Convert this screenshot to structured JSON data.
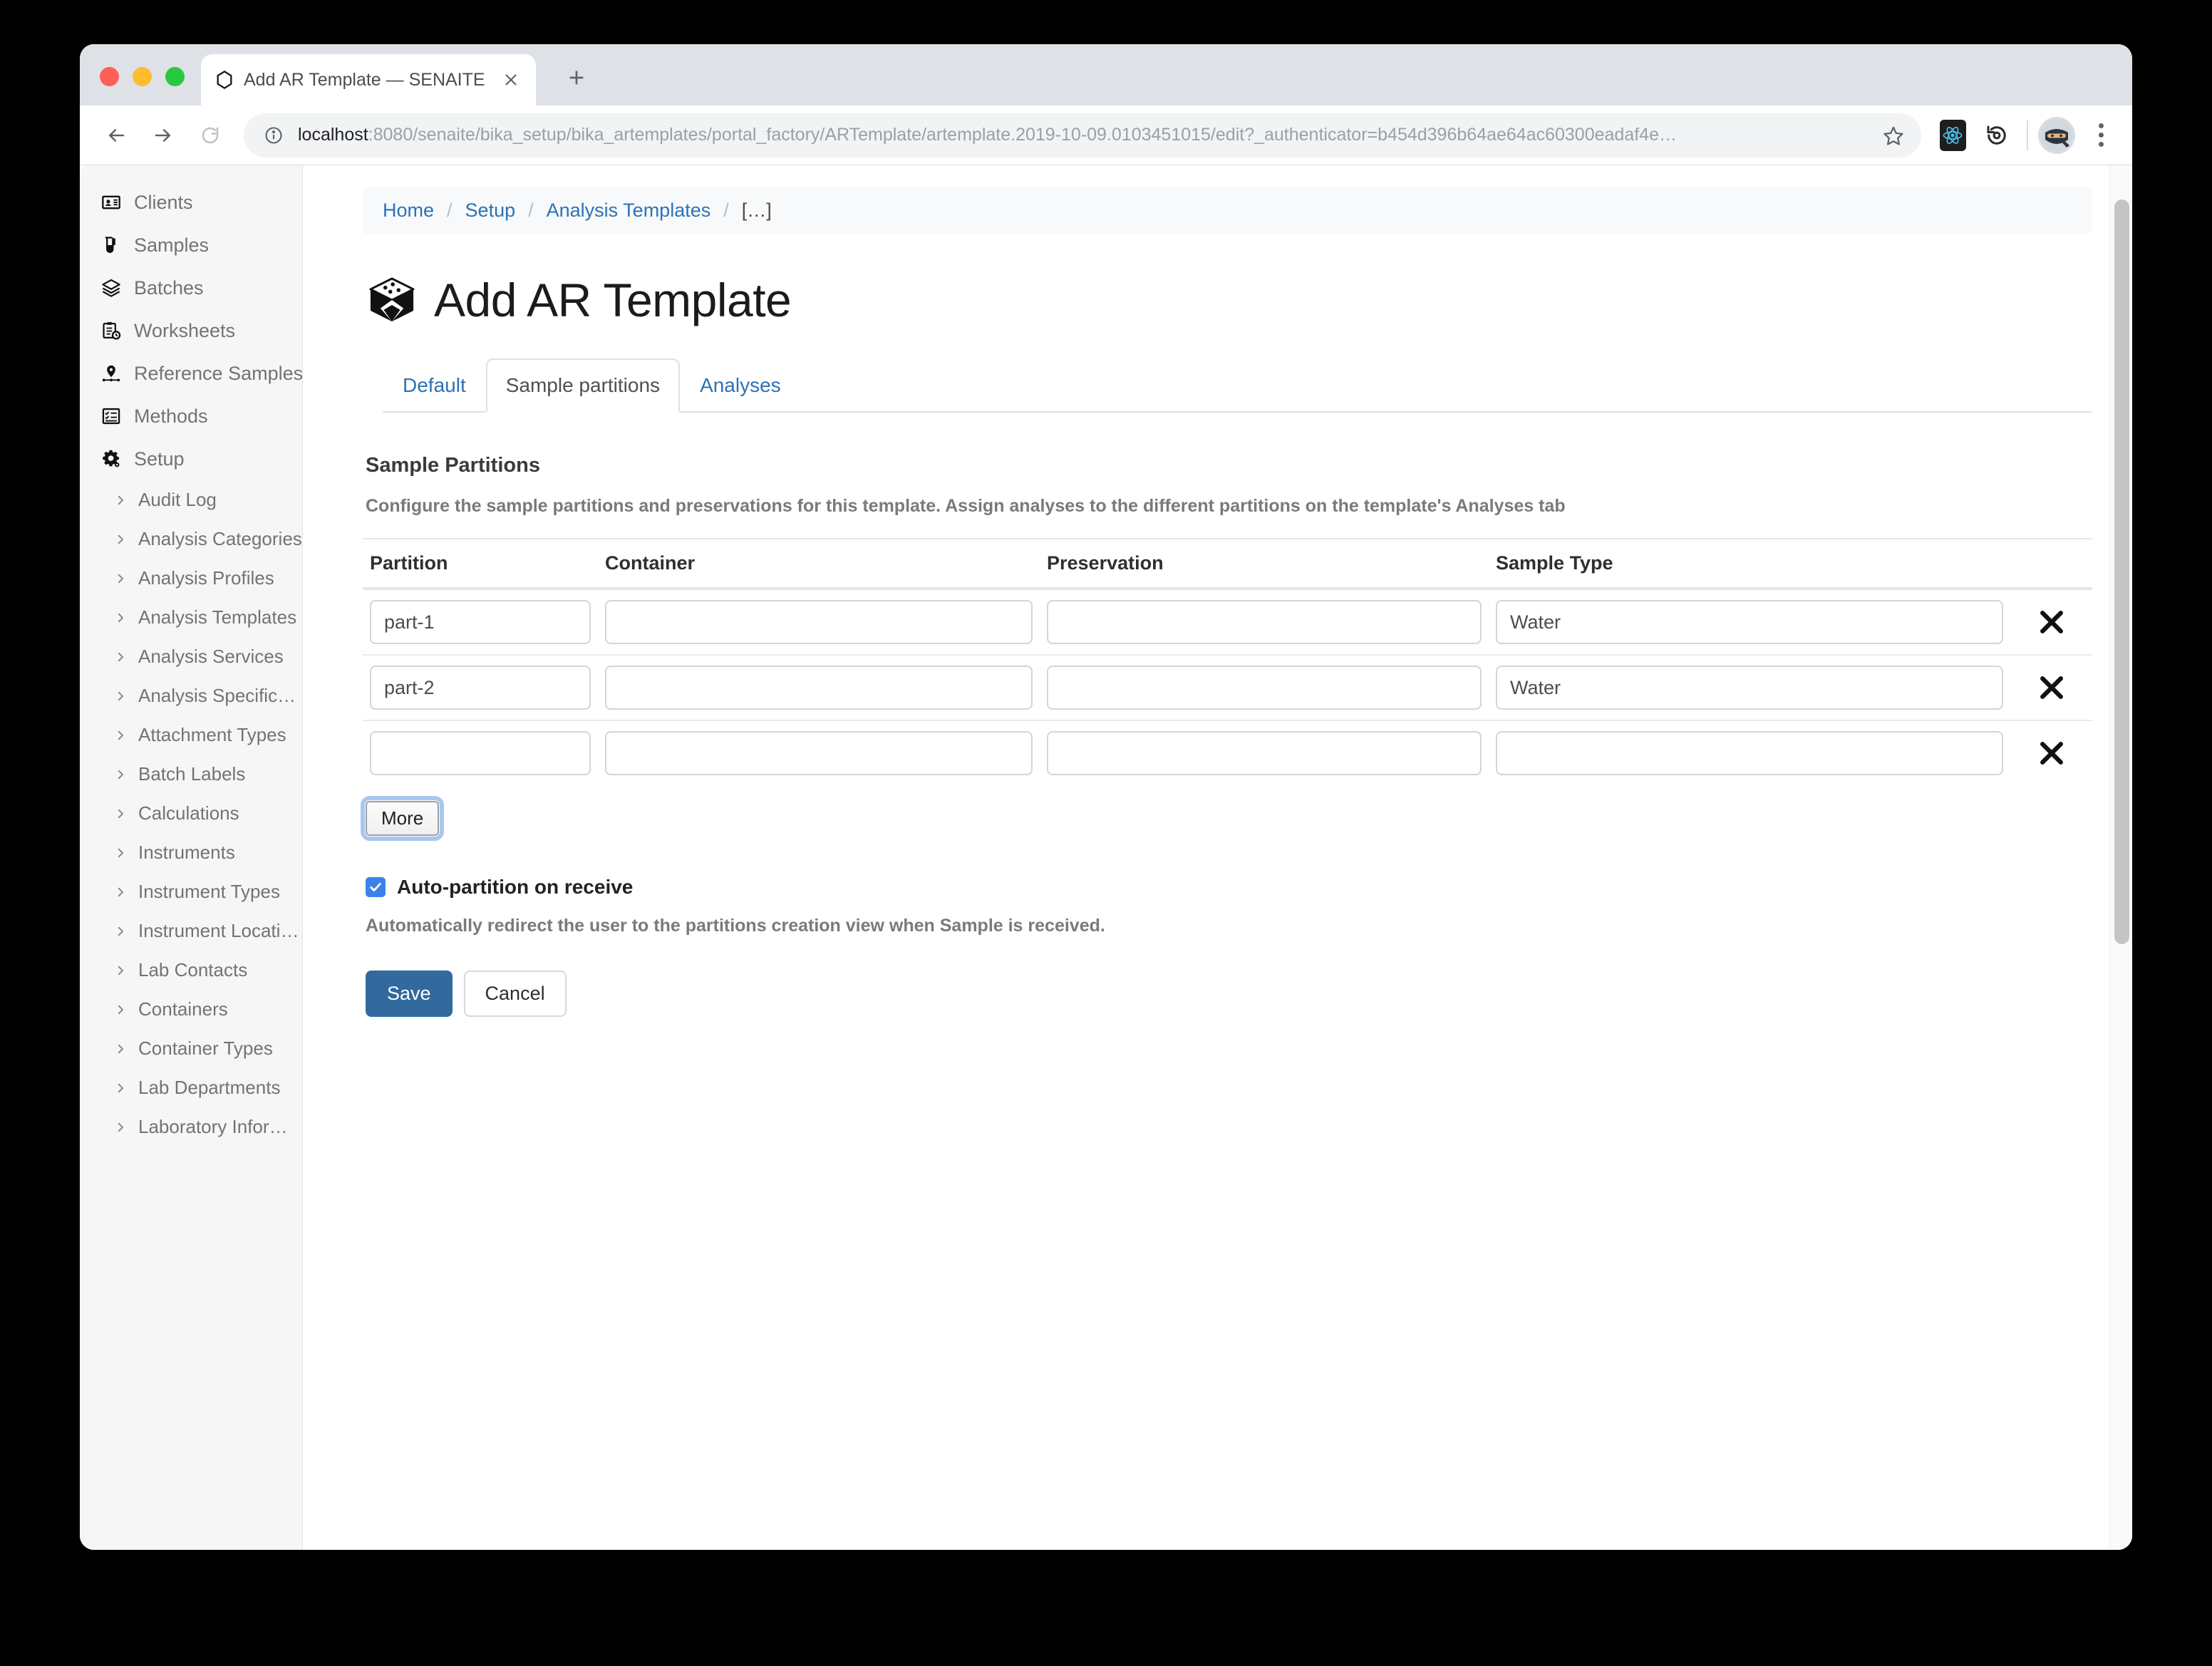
{
  "browser": {
    "tab": {
      "title": "Add AR Template — SENAITE",
      "favicon_icon": "senaite-hexagon-icon",
      "close_icon": "close-icon"
    },
    "new_tab_icon": "plus-icon",
    "nav": {
      "back_icon": "arrow-left-icon",
      "forward_icon": "arrow-right-icon",
      "reload_icon": "reload-icon"
    },
    "omnibox": {
      "info_icon": "info-circle-icon",
      "host": "localhost",
      "path": ":8080/senaite/bika_setup/bika_artemplates/portal_factory/ARTemplate/artemplate.2019-10-09.0103451015/edit?_authenticator=b454d396b64ae64ac60300eadaf4e…",
      "star_icon": "star-icon"
    },
    "extensions": [
      {
        "name": "react-devtools-icon"
      },
      {
        "name": "refresh-timer-icon"
      }
    ],
    "avatar_icon": "ninja-avatar-icon",
    "menu_icon": "kebab-menu-icon"
  },
  "sidebar": {
    "items": [
      {
        "label": "Clients",
        "icon": "id-card-icon"
      },
      {
        "label": "Samples",
        "icon": "test-tube-icon"
      },
      {
        "label": "Batches",
        "icon": "layers-icon"
      },
      {
        "label": "Worksheets",
        "icon": "clipboard-clock-icon"
      },
      {
        "label": "Reference Samples",
        "icon": "map-pin-icon"
      },
      {
        "label": "Methods",
        "icon": "checklist-icon"
      },
      {
        "label": "Setup",
        "icon": "gear-icon"
      }
    ],
    "setup_items": [
      {
        "label": "Audit Log"
      },
      {
        "label": "Analysis Categories"
      },
      {
        "label": "Analysis Profiles"
      },
      {
        "label": "Analysis Templates"
      },
      {
        "label": "Analysis Services"
      },
      {
        "label": "Analysis Specificati…"
      },
      {
        "label": "Attachment Types"
      },
      {
        "label": "Batch Labels"
      },
      {
        "label": "Calculations"
      },
      {
        "label": "Instruments"
      },
      {
        "label": "Instrument Types"
      },
      {
        "label": "Instrument Locations"
      },
      {
        "label": "Lab Contacts"
      },
      {
        "label": "Containers"
      },
      {
        "label": "Container Types"
      },
      {
        "label": "Lab Departments"
      },
      {
        "label": "Laboratory Informati…"
      }
    ]
  },
  "breadcrumb": {
    "items": [
      {
        "label": "Home",
        "link": true
      },
      {
        "label": "Setup",
        "link": true
      },
      {
        "label": "Analysis Templates",
        "link": true
      },
      {
        "label": "[…]",
        "link": false
      }
    ],
    "separator": "/"
  },
  "page": {
    "title": "Add AR Template",
    "title_icon": "cube-icon"
  },
  "tabs": [
    {
      "label": "Default",
      "active": false
    },
    {
      "label": "Sample partitions",
      "active": true
    },
    {
      "label": "Analyses",
      "active": false
    }
  ],
  "partitions_section": {
    "heading": "Sample Partitions",
    "description": "Configure the sample partitions and preservations for this template. Assign analyses to the different partitions on the template's Analyses tab",
    "columns": [
      "Partition",
      "Container",
      "Preservation",
      "Sample Type"
    ],
    "remove_icon": "close-x-icon",
    "rows": [
      {
        "partition": "part-1",
        "container": "",
        "preservation": "",
        "sample_type": "Water"
      },
      {
        "partition": "part-2",
        "container": "",
        "preservation": "",
        "sample_type": "Water"
      },
      {
        "partition": "",
        "container": "",
        "preservation": "",
        "sample_type": ""
      }
    ],
    "more_button": "More"
  },
  "auto_partition": {
    "checked": true,
    "label": "Auto-partition on receive",
    "description": "Automatically redirect the user to the partitions creation view when Sample is received.",
    "check_icon": "check-icon"
  },
  "form_actions": {
    "save": "Save",
    "cancel": "Cancel"
  },
  "colors": {
    "link": "#2c72b5",
    "primary_button": "#32699e",
    "checkbox": "#3b82e8",
    "sidebar_bg": "#f6f6f6"
  }
}
